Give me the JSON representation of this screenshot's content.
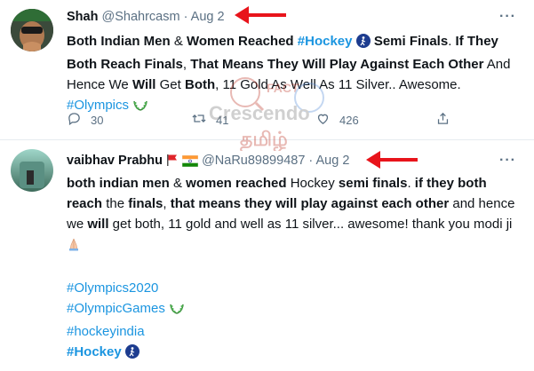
{
  "tweet1": {
    "name": "Shah",
    "handle": "@Shahrcasm",
    "sep": "·",
    "date": "Aug 2",
    "more": "···",
    "l1a": "Both Indian Men",
    "l1b": " & ",
    "l1c": "Women Reached",
    "l1d": " ",
    "l1tag": "#Hockey",
    "l1e": " Semi Finals",
    "l1f": ". ",
    "l1g": "If They",
    "l2a": "Both Reach Finals",
    "l2b": ", ",
    "l2c": "That Means They Will Play Against Each Other",
    "l2d": " And",
    "l3a": "Hence We ",
    "l3b": "Will",
    "l3c": " Get ",
    "l3d": "Both",
    "l3e": ", 11 Gold As Well As 11 Silver.. Awesome.",
    "l4tag": "#Olympics",
    "reply_count": "30",
    "retweet_count": "41",
    "like_count": "426"
  },
  "tweet2": {
    "name": "vaibhav Prabhu",
    "handle": "@NaRu89899487",
    "sep": "·",
    "date": "Aug 2",
    "more": "···",
    "l1a": "both indian men",
    "l1b": " & ",
    "l1c": "women reached",
    "l1d": " Hockey ",
    "l1e": "semi finals",
    "l1f": ". ",
    "l1g": "if they both",
    "l2a": "reach",
    "l2b": " the ",
    "l2c": "finals",
    "l2d": ", ",
    "l2e": "that means they will play against each other",
    "l2f": " and hence",
    "l3a": "we ",
    "l3b": "will",
    "l3c": " get both, 11 gold and well as 11 silver...  awesome! thank you modi ji",
    "tag1": "#Olympics2020",
    "tag2": "#OlympicGames",
    "tag3": "#hockeyindia",
    "tag4": "#Hockey"
  },
  "watermark": {
    "fact": "FACT",
    "crescendo": "Crescendo",
    "tamil": "தமிழ்"
  },
  "colors": {
    "link": "#1b95e0",
    "muted": "#5b7083",
    "arrow": "#e8141b"
  }
}
